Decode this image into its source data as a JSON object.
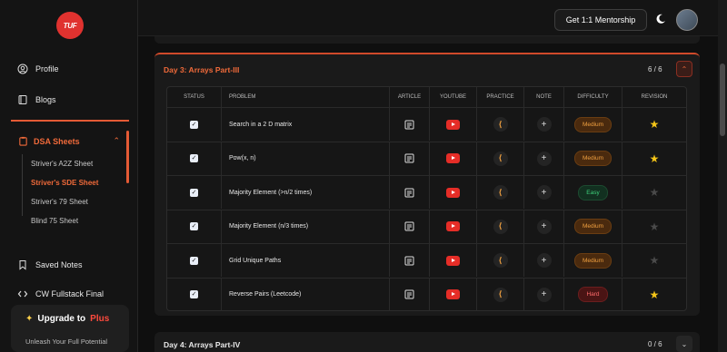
{
  "sidebar": {
    "logo_text": "TUF",
    "profile_label": "Profile",
    "blogs_label": "Blogs",
    "dsa_label": "DSA Sheets",
    "sheets": [
      "Striver's A2Z Sheet",
      "Striver's SDE Sheet",
      "Striver's 79 Sheet",
      "Blind 75 Sheet"
    ],
    "saved_notes_label": "Saved Notes",
    "cw_label": "CW Fullstack Final",
    "upgrade_prefix": "Upgrade to",
    "upgrade_plus": "Plus",
    "upgrade_sub": "Unleash Your Full Potential"
  },
  "topbar": {
    "mentorship_label": "Get 1:1 Mentorship"
  },
  "section": {
    "title": "Day 3: Arrays Part-III",
    "count": "6 / 6",
    "headers": [
      "STATUS",
      "PROBLEM",
      "ARTICLE",
      "YOUTUBE",
      "PRACTICE",
      "NOTE",
      "DIFFICULTY",
      "REVISION"
    ],
    "rows": [
      {
        "problem": "Search in a 2 D matrix",
        "difficulty": "Medium",
        "starred": true
      },
      {
        "problem": "Pow(x, n)",
        "difficulty": "Medium",
        "starred": true
      },
      {
        "problem": "Majority Element (>n/2 times)",
        "difficulty": "Easy",
        "starred": false
      },
      {
        "problem": "Majority Element (n/3 times)",
        "difficulty": "Medium",
        "starred": false
      },
      {
        "problem": "Grid Unique Paths",
        "difficulty": "Medium",
        "starred": false
      },
      {
        "problem": "Reverse Pairs (Leetcode)",
        "difficulty": "Hard",
        "starred": true
      }
    ]
  },
  "next_section": {
    "title": "Day 4: Arrays Part-IV",
    "count": "0 / 6"
  },
  "colors": {
    "accent": "#f06a3a",
    "star_on": "#f5c518",
    "star_off": "#4a4a4a"
  }
}
